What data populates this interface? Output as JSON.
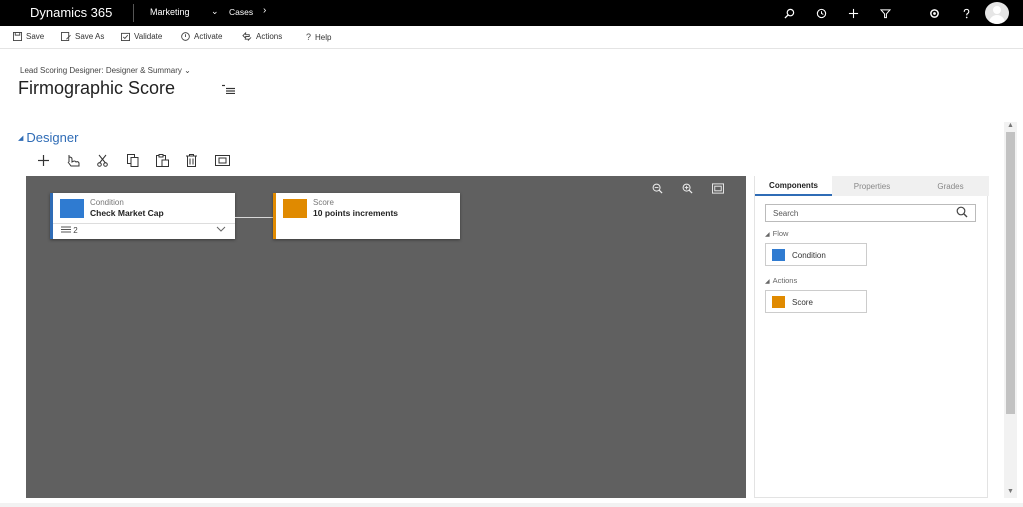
{
  "topnav": {
    "brand": "Dynamics 365",
    "area": "Marketing",
    "area_chevron": "⌄",
    "entity": "Cases",
    "entity_arrow": "›",
    "icons": [
      "search-icon",
      "recent-icon",
      "new-icon",
      "filter-icon",
      "settings-icon",
      "help-icon"
    ]
  },
  "commands": {
    "save": "Save",
    "save_as": "Save As",
    "validate": "Validate",
    "activate": "Activate",
    "actions": "Actions",
    "help": "Help"
  },
  "header": {
    "subtitle": "Lead Scoring Designer: Designer & Summary",
    "subtitle_chevron": "⌄",
    "title": "Firmographic Score"
  },
  "designer": {
    "section_title": "Designer",
    "toolbar_icons": [
      "add-icon",
      "touch-icon",
      "cut-icon",
      "copy-icon",
      "paste-icon",
      "delete-icon",
      "snapshot-icon"
    ],
    "zoom_icons": [
      "zoom-out-icon",
      "zoom-in-icon",
      "fit-screen-icon"
    ],
    "nodes": {
      "condition": {
        "type": "Condition",
        "name": "Check Market Cap",
        "count": "2",
        "color": "#2f7bd1"
      },
      "score": {
        "type": "Score",
        "name": "10 points increments",
        "color": "#e08a00"
      }
    }
  },
  "panel": {
    "tabs": [
      "Components",
      "Properties",
      "Grades"
    ],
    "active_tab": "Components",
    "search_placeholder": "Search",
    "groups": {
      "flow": {
        "label": "Flow",
        "items": [
          "Condition"
        ]
      },
      "actions": {
        "label": "Actions",
        "items": [
          "Score"
        ]
      }
    }
  },
  "colors": {
    "accent": "#2f6cb6",
    "canvas": "#606060",
    "condition": "#2f7bd1",
    "score": "#e08a00"
  }
}
